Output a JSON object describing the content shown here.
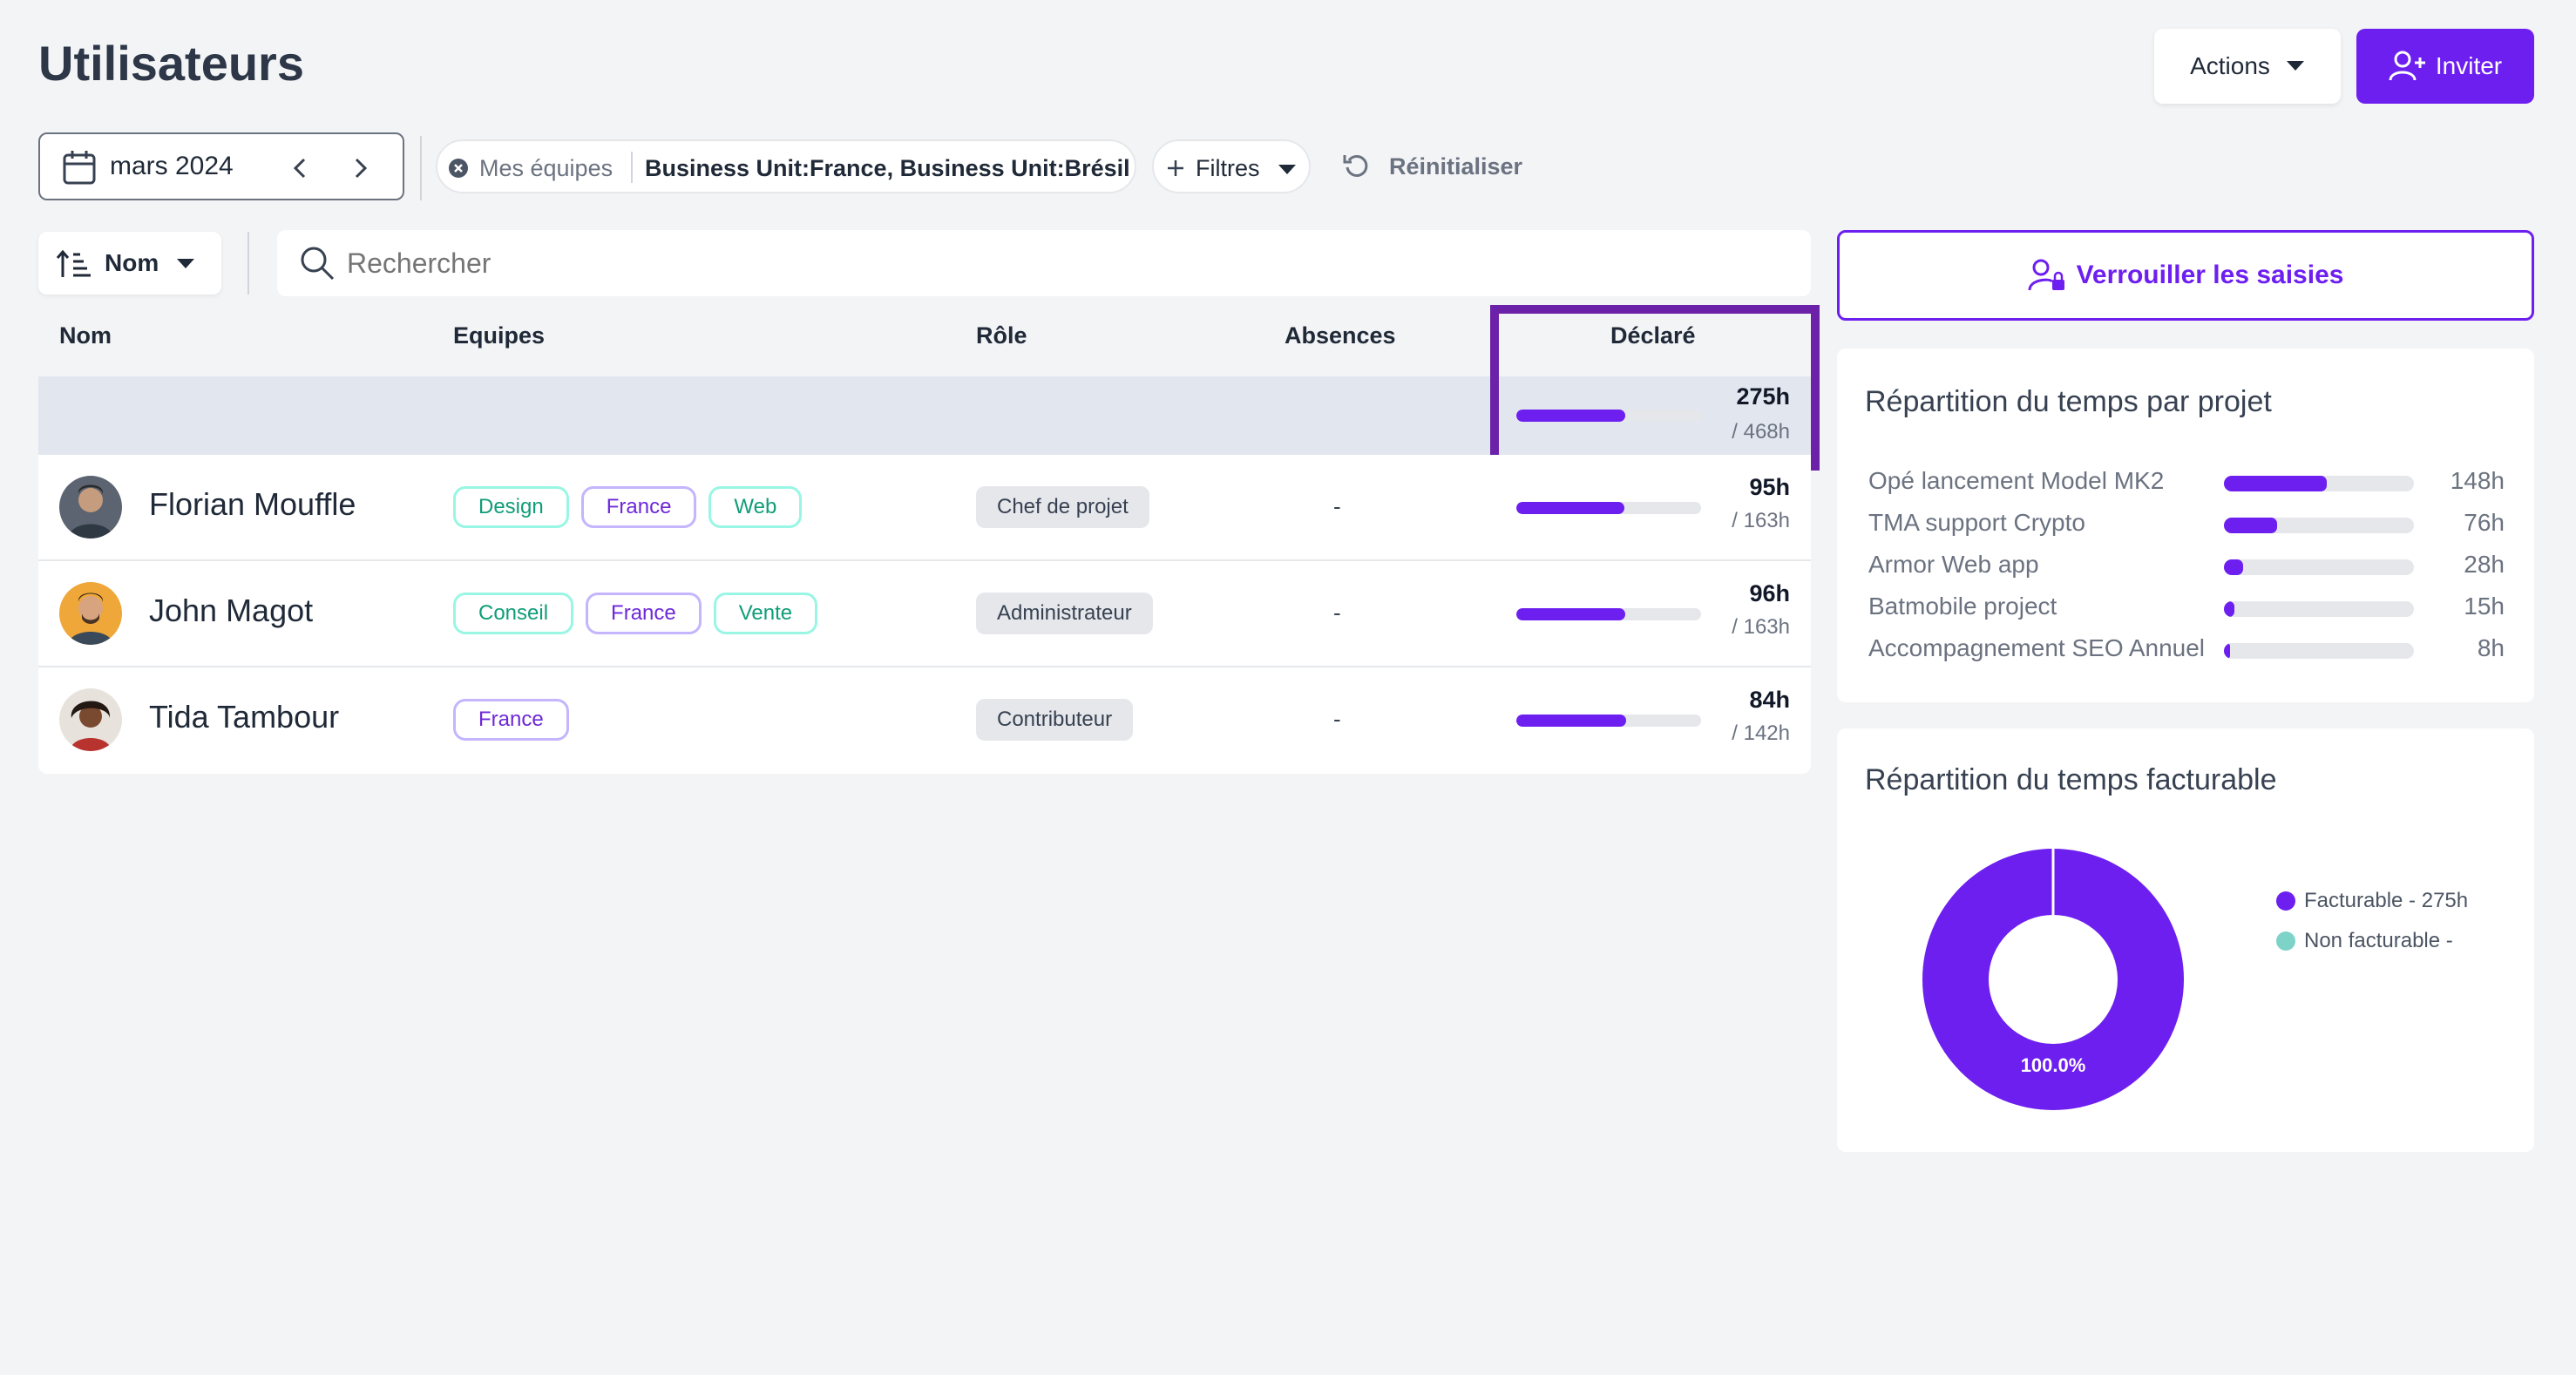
{
  "header": {
    "title": "Utilisateurs",
    "actions_label": "Actions",
    "invite_label": "Inviter"
  },
  "filters": {
    "month": "mars 2024",
    "team_label": "Mes équipes",
    "team_value": "Business Unit:France, Business Unit:Brésil",
    "filters_label": "Filtres",
    "reset_label": "Réinitialiser"
  },
  "toolbar": {
    "sort_label": "Nom",
    "search_placeholder": "Rechercher"
  },
  "table": {
    "columns": {
      "name": "Nom",
      "teams": "Equipes",
      "role": "Rôle",
      "absences": "Absences",
      "declared": "Déclaré"
    },
    "total": {
      "hours": "275h",
      "capacity": "/ 468h",
      "ratio": 0.588
    },
    "rows": [
      {
        "name": "Florian Mouffle",
        "teams": [
          {
            "label": "Design",
            "color": "green"
          },
          {
            "label": "France",
            "color": "purple"
          },
          {
            "label": "Web",
            "color": "green"
          }
        ],
        "role": "Chef de projet",
        "absences": "-",
        "hours": "95h",
        "capacity": "/ 163h",
        "ratio": 0.583
      },
      {
        "name": "John Magot",
        "teams": [
          {
            "label": "Conseil",
            "color": "green"
          },
          {
            "label": "France",
            "color": "purple"
          },
          {
            "label": "Vente",
            "color": "green"
          }
        ],
        "role": "Administrateur",
        "absences": "-",
        "hours": "96h",
        "capacity": "/ 163h",
        "ratio": 0.589
      },
      {
        "name": "Tida Tambour",
        "teams": [
          {
            "label": "France",
            "color": "purple"
          }
        ],
        "role": "Contributeur",
        "absences": "-",
        "hours": "84h",
        "capacity": "/ 142h",
        "ratio": 0.592
      }
    ]
  },
  "lock": {
    "label": "Verrouiller les saisies"
  },
  "projects": {
    "title": "Répartition du temps par projet",
    "items": [
      {
        "name": "Opé lancement Model MK2",
        "value": "148h",
        "ratio": 0.54
      },
      {
        "name": "TMA support Crypto",
        "value": "76h",
        "ratio": 0.28
      },
      {
        "name": "Armor Web app",
        "value": "28h",
        "ratio": 0.1
      },
      {
        "name": "Batmobile project",
        "value": "15h",
        "ratio": 0.055
      },
      {
        "name": "Accompagnement SEO Annuel",
        "value": "8h",
        "ratio": 0.03
      }
    ]
  },
  "billable": {
    "title": "Répartition du temps facturable",
    "center_label": "100.0%",
    "legend": [
      {
        "label": "Facturable - 275h",
        "color": "#6d1ff0"
      },
      {
        "label": "Non facturable -",
        "color": "#7dd3c8"
      }
    ]
  },
  "chart_data": {
    "type": "pie",
    "title": "Répartition du temps facturable",
    "categories": [
      "Facturable",
      "Non facturable"
    ],
    "values": [
      275,
      0
    ],
    "labels": [
      "100.0%"
    ],
    "legend": "right"
  },
  "colors": {
    "accent": "#6d1ff0",
    "highlight_border": "#6b21a8",
    "non_billable": "#7dd3c8"
  }
}
